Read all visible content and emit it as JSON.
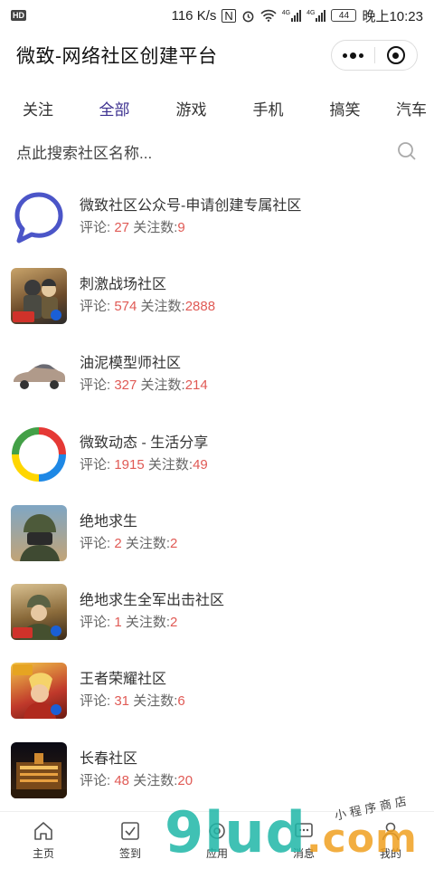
{
  "status_bar": {
    "hd": "HD",
    "speed": "116 K/s",
    "signal_1": "4G",
    "signal_2": "4G",
    "battery": "44",
    "time": "晚上10:23"
  },
  "app": {
    "title": "微致-网络社区创建平台"
  },
  "tabs": [
    {
      "label": "关注"
    },
    {
      "label": "全部",
      "active": true
    },
    {
      "label": "游戏"
    },
    {
      "label": "手机"
    },
    {
      "label": "搞笑"
    },
    {
      "label": "汽车"
    }
  ],
  "search": {
    "placeholder": "点此搜索社区名称..."
  },
  "stats_labels": {
    "comments": "评论: ",
    "followers": " 关注数:"
  },
  "communities": [
    {
      "name": "微致社区公众号-申请创建专属社区",
      "comments": "27",
      "followers": "9",
      "icon": "chat-bubble-icon"
    },
    {
      "name": "刺激战场社区",
      "comments": "574",
      "followers": "2888",
      "icon": "game-soldier-icon"
    },
    {
      "name": "油泥模型师社区",
      "comments": "327",
      "followers": "214",
      "icon": "model-car-icon"
    },
    {
      "name": "微致动态 - 生活分享",
      "comments": "1915",
      "followers": "49",
      "icon": "color-ring-icon"
    },
    {
      "name": "绝地求生",
      "comments": "2",
      "followers": "2",
      "icon": "pubg-helmet-icon"
    },
    {
      "name": "绝地求生全军出击社区",
      "comments": "1",
      "followers": "2",
      "icon": "pubg-game-icon"
    },
    {
      "name": "王者荣耀社区",
      "comments": "31",
      "followers": "6",
      "icon": "hero-game-icon"
    },
    {
      "name": "长春社区",
      "comments": "48",
      "followers": "20",
      "icon": "city-night-icon"
    }
  ],
  "bottom_tabs": [
    {
      "label": "主页",
      "icon": "home-icon"
    },
    {
      "label": "签到",
      "icon": "checkin-icon"
    },
    {
      "label": "应用",
      "icon": "apps-icon"
    },
    {
      "label": "消息",
      "icon": "message-icon"
    },
    {
      "label": "我的",
      "icon": "profile-icon"
    }
  ],
  "watermark": {
    "logo_text": "9lud",
    "logo_suffix": ".com",
    "tagline": "小程序商店"
  },
  "colors": {
    "accent_tab": "#3b2f8f",
    "number": "#e05a55",
    "watermark_teal": "#1fb7a8",
    "watermark_orange": "#f0a020"
  }
}
